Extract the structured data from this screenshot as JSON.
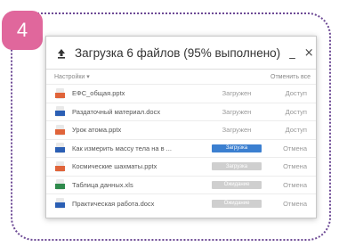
{
  "step_badge": "4",
  "dialog": {
    "title": "Загрузка 6 файлов (95% выполнено)",
    "minimize": "_",
    "close": "×"
  },
  "toolbar": {
    "settings": "Настройки ▾",
    "cancel_all": "Отменить все"
  },
  "colors": {
    "frame": "#6d4a95",
    "badge": "#e0679c",
    "progress_active": "#3b7fd0",
    "progress_pending": "#cfcfcf",
    "pptx": "#e0643a",
    "docx": "#2b5fb4",
    "xls": "#2f8a4c"
  },
  "files": [
    {
      "name": "ЕФС_общая.pptx",
      "type": "pptx",
      "status": "Загружен",
      "action": "Доступ",
      "progress": 1.0
    },
    {
      "name": "Раздаточный материал.docx",
      "type": "docx",
      "status": "Загружен",
      "action": "Доступ",
      "progress": 1.0
    },
    {
      "name": "Урок атома.pptx",
      "type": "pptx",
      "status": "Загружен",
      "action": "Доступ",
      "progress": 1.0
    },
    {
      "name": "Как измерить массу тела на в ...",
      "type": "docx",
      "status": "Загрузка",
      "action": "Отмена",
      "progress": 0.6
    },
    {
      "name": "Космические шахматы.pptx",
      "type": "pptx",
      "status": "Загрузка",
      "action": "Отмена",
      "progress": 0.0
    },
    {
      "name": "Таблица данных.xls",
      "type": "xls",
      "status": "Ожидание",
      "action": "Отмена",
      "progress": 0.0
    },
    {
      "name": "Практическая работа.docx",
      "type": "docx",
      "status": "Ожидание",
      "action": "Отмена",
      "progress": 0.0
    }
  ]
}
